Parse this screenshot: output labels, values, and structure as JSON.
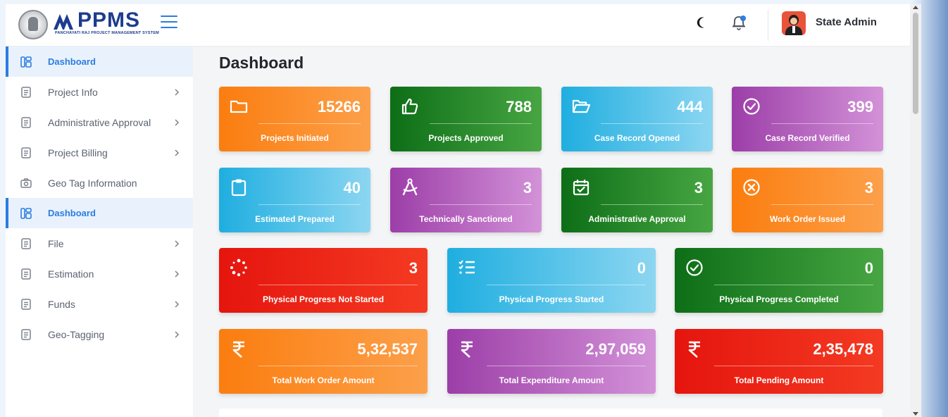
{
  "header": {
    "logo_text": "PPMS",
    "logo_subtitle": "PANCHAYATI RAJ PROJECT MANAGEMENT SYSTEM",
    "user_name": "State Admin",
    "icons": [
      "menu-icon",
      "moon-icon",
      "bell-icon",
      "avatar"
    ]
  },
  "sidebar": {
    "items": [
      {
        "label": "Dashboard",
        "icon": "dashboard-icon",
        "active": true,
        "has_arrow": false
      },
      {
        "label": "Project Info",
        "icon": "document-icon",
        "active": false,
        "has_arrow": true
      },
      {
        "label": "Administrative Approval",
        "icon": "document-icon",
        "active": false,
        "has_arrow": true
      },
      {
        "label": "Project Billing",
        "icon": "document-icon",
        "active": false,
        "has_arrow": true
      },
      {
        "label": "Geo Tag Information",
        "icon": "camera-icon",
        "active": false,
        "has_arrow": false
      },
      {
        "label": "Dashboard",
        "icon": "dashboard-icon",
        "active": true,
        "has_arrow": false
      },
      {
        "label": "File",
        "icon": "document-icon",
        "active": false,
        "has_arrow": true
      },
      {
        "label": "Estimation",
        "icon": "document-icon",
        "active": false,
        "has_arrow": true
      },
      {
        "label": "Funds",
        "icon": "document-icon",
        "active": false,
        "has_arrow": true
      },
      {
        "label": "Geo-Tagging",
        "icon": "document-icon",
        "active": false,
        "has_arrow": true
      }
    ]
  },
  "main": {
    "title": "Dashboard",
    "row1": [
      {
        "value": "15266",
        "label": "Projects Initiated",
        "color": "orange",
        "icon": "folder-icon"
      },
      {
        "value": "788",
        "label": "Projects Approved",
        "color": "green",
        "icon": "thumbs-up-icon"
      },
      {
        "value": "444",
        "label": "Case Record Opened",
        "color": "cyan",
        "icon": "folder-open-icon"
      },
      {
        "value": "399",
        "label": "Case Record Verified",
        "color": "purple",
        "icon": "check-circle-icon"
      }
    ],
    "row2": [
      {
        "value": "40",
        "label": "Estimated Prepared",
        "color": "cyan",
        "icon": "clipboard-icon"
      },
      {
        "value": "3",
        "label": "Technically Sanctioned",
        "color": "purple",
        "icon": "compass-icon"
      },
      {
        "value": "3",
        "label": "Administrative Approval",
        "color": "green",
        "icon": "calendar-check-icon"
      },
      {
        "value": "3",
        "label": "Work Order Issued",
        "color": "orange",
        "icon": "x-circle-icon"
      }
    ],
    "row3": [
      {
        "value": "3",
        "label": "Physical Progress Not Started",
        "color": "red",
        "icon": "spinner-icon"
      },
      {
        "value": "0",
        "label": "Physical Progress Started",
        "color": "cyan",
        "icon": "list-check-icon"
      },
      {
        "value": "0",
        "label": "Physical Progress Completed",
        "color": "green",
        "icon": "check-circle-icon"
      }
    ],
    "row4": [
      {
        "value": "5,32,537",
        "label": "Total Work Order Amount",
        "color": "orange",
        "icon": "rupee-icon"
      },
      {
        "value": "2,97,059",
        "label": "Total Expenditure Amount",
        "color": "purple",
        "icon": "rupee-icon"
      },
      {
        "value": "2,35,478",
        "label": "Total Pending Amount",
        "color": "red",
        "icon": "rupee-icon"
      }
    ]
  },
  "colors": {
    "accent": "#2a7de1",
    "orange": "#fb7d0f",
    "green": "#0d6e17",
    "cyan": "#1faee0",
    "purple": "#9c3ea8",
    "red": "#e5150e"
  }
}
